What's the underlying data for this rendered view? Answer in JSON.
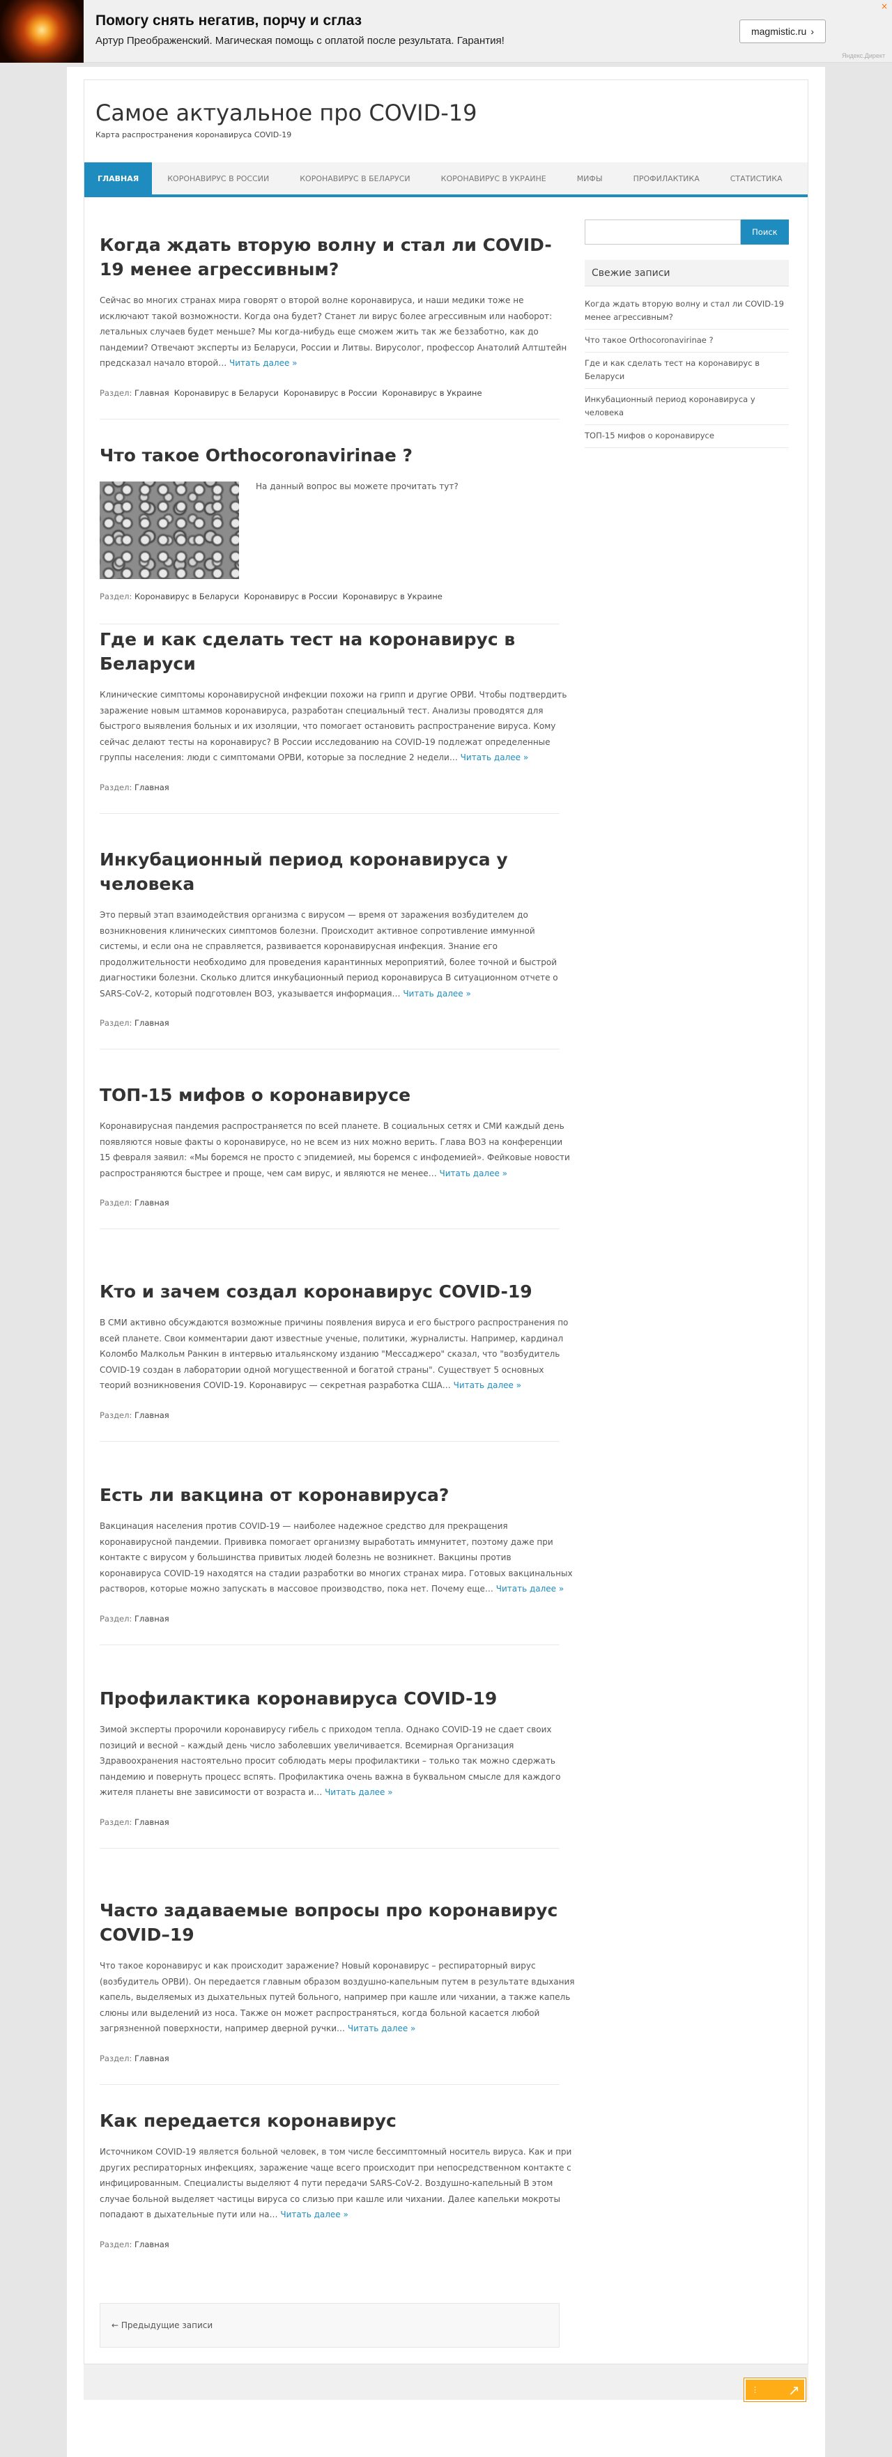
{
  "ad": {
    "title": "Помогу снять негатив, порчу и сглаз",
    "text": "Артур Преображенский. Магическая помощь с оплатой после результата. Гарантия!",
    "button": "magmistic.ru",
    "button_icon": "chevron-right-icon",
    "close": "×",
    "label": "Яндекс.Директ"
  },
  "site": {
    "title": "Самое актуальное про COVID-19",
    "description": "Карта распространения коронавируса COVID-19"
  },
  "nav": [
    "ГЛАВНАЯ",
    "КОРОНАВИРУС В РОССИИ",
    "КОРОНАВИРУС В БЕЛАРУСИ",
    "КОРОНАВИРУС В УКРАИНЕ",
    "МИФЫ",
    "ПРОФИЛАКТИКА",
    "СТАТИСТИКА"
  ],
  "labels": {
    "read_more": "Читать далее »",
    "category_prefix": "Раздел:",
    "prev_posts": "← Предыдущие записи"
  },
  "posts": [
    {
      "title": "Когда ждать вторую волну и стал ли COVID-19 менее агрессивным?",
      "excerpt": "Сейчас во многих странах мира говорят о второй волне коронавируса, и наши медики тоже не исключают такой возможности. Когда она будет? Станет ли вирус более агрессивным или наоборот: летальных случаев будет меньше? Мы когда-нибудь еще сможем жить так же беззаботно, как до пандемии? Отвечают эксперты из Беларуси, России и Литвы. Вирусолог, профессор Анатолий Алтштейн предсказал начало второй…",
      "categories": [
        "Главная",
        "Коронавирус в Беларуси",
        "Коронавирус в России",
        "Коронавирус в Украине"
      ]
    },
    {
      "title": "Что такое Orthocoronavirinae ?",
      "excerpt": "На данный вопрос вы можете прочитать тут?",
      "categories": [
        "Коронавирус в Беларуси",
        "Коронавирус в России",
        "Коронавирус в Украине"
      ]
    },
    {
      "title": "Где и как сделать тест на коронавирус в Беларуси",
      "excerpt": "Клинические симптомы коронавирусной инфекции похожи на грипп и другие ОРВИ. Чтобы подтвердить заражение новым штаммов коронавируса, разработан специальный тест. Анализы проводятся для быстрого выявления больных и их изоляции, что помогает остановить распространение вируса. Кому сейчас делают тесты на коронавирус? В России исследованию на COVID-19 подлежат определенные группы населения: люди с симптомами ОРВИ, которые за последние 2 недели…",
      "categories": [
        "Главная"
      ]
    },
    {
      "title": "Инкубационный период коронавируса у человека",
      "excerpt": "Это первый этап взаимодействия организма с вирусом — время от заражения возбудителем до возникновения клинических симптомов болезни. Происходит активное сопротивление иммунной системы, и если она не справляется, развивается коронавирусная инфекция. Знание его продолжительности необходимо для проведения карантинных мероприятий, более точной и быстрой диагностики болезни. Сколько длится инкубационный период коронавируса В ситуационном отчете о SARS-CoV-2, который подготовлен ВОЗ, указывается информация…",
      "categories": [
        "Главная"
      ]
    },
    {
      "title": "ТОП-15 мифов о коронавирусе",
      "excerpt": "Коронавирусная пандемия распространяется по всей планете. В социальных сетях и СМИ каждый день появляются новые факты о коронавирусе, но не всем из них можно верить. Глава ВОЗ на конференции 15 февраля заявил: «Мы боремся не просто с эпидемией, мы боремся с инфодемией». Фейковые новости распространяются быстрее и проще, чем сам вирус, и являются не менее…",
      "categories": [
        "Главная"
      ]
    },
    {
      "title": "Кто и зачем создал коронавирус COVID-19",
      "excerpt": "В СМИ активно обсуждаются возможные причины появления вируса и его быстрого распространения по всей планете. Свои комментарии дают известные ученые, политики, журналисты. Например, кардинал Коломбо Малкольм Ранкин в интервью итальянскому изданию \"Мессаджеро\" сказал, что \"возбудитель COVID-19 создан в лаборатории одной могущественной и богатой страны\". Существует 5 основных теорий возникновения COVID-19. Коронавирус — секретная разработка США…",
      "categories": [
        "Главная"
      ]
    },
    {
      "title": "Есть ли вакцина от коронавируса?",
      "excerpt": "Вакцинация населения против COVID-19 — наиболее надежное средство для прекращения коронавирусной пандемии. Прививка помогает организму выработать иммунитет, поэтому даже при контакте с вирусом у большинства привитых людей болезнь не возникнет. Вакцины против коронавируса COVID-19 находятся на стадии разработки во многих странах мира. Готовых вакцинальных растворов, которые можно запускать в массовое производство, пока нет. Почему еще…",
      "categories": [
        "Главная"
      ]
    },
    {
      "title": "Профилактика коронавируса COVID-19",
      "excerpt": "Зимой эксперты пророчили коронавирусу гибель с приходом тепла. Однако COVID-19 не сдает своих позиций и весной – каждый день число заболевших увеличивается. Всемирная Организация Здравоохранения настоятельно просит соблюдать меры профилактики – только так можно сдержать пандемию и повернуть процесс вспять. Профилактика очень важна в буквальном смысле для каждого жителя планеты вне зависимости от возраста и…",
      "categories": [
        "Главная"
      ]
    },
    {
      "title": "Часто задаваемые вопросы про коронавирус COVID–19",
      "excerpt": "Что такое коронавирус и как происходит заражение? Новый коронавирус – респираторный вирус (возбудитель ОРВИ). Он передается главным образом воздушно-капельным путем в результате вдыхания капель, выделяемых из дыхательных путей больного, например при кашле или чихании, а также капель слюны или выделений из носа. Также он может распространяться, когда больной касается любой загрязненной поверхности, например дверной ручки…",
      "categories": [
        "Главная"
      ]
    },
    {
      "title": "Как передается коронавирус",
      "excerpt": "Источником COVID-19 является больной человек, в том числе бессимптомный носитель вируса. Как и при других респираторных инфекциях, заражение чаще всего происходит при непосредственном контакте с инфицированным. Специалисты выделяют 4 пути передачи SARS-CoV-2. Воздушно-капельный В этом случае больной выделяет частицы вируса со слизью при кашле или чихании. Далее капельки мокроты попадают в дыхательные пути или на…",
      "categories": [
        "Главная"
      ]
    }
  ],
  "sidebar": {
    "search_button": "Поиск",
    "search_value": "",
    "recent_title": "Свежие записи",
    "recent": [
      "Когда ждать вторую волну и стал ли COVID-19 менее агрессивным?",
      "Что такое Orthocoronavirinae ?",
      "Где и как сделать тест на коронавирус в Беларуси",
      "Инкубационный период коронавируса у человека",
      "ТОП-15 мифов о коронавирусе"
    ]
  },
  "colors": {
    "accent": "#1e8cbe",
    "ad_button": "#ffad16"
  },
  "floating_ad_icon": "arrow-up-right-icon"
}
